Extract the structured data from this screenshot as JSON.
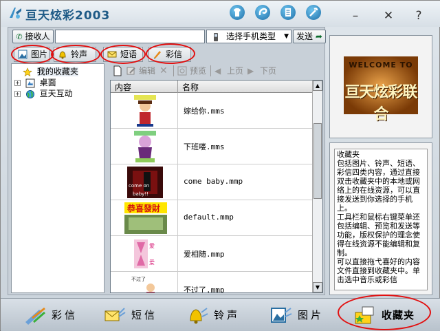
{
  "app": {
    "title": "亘天炫彩2003",
    "controls": {
      "minimize": "–",
      "close": "✕",
      "help": "?"
    }
  },
  "recipient": {
    "button_label": "接收人",
    "input_value": "",
    "phone_select": "选择手机类型",
    "send_label": "发送"
  },
  "tabs": [
    {
      "label": "图片",
      "icon": "picture-icon"
    },
    {
      "label": "铃声",
      "icon": "bell-icon"
    },
    {
      "label": "短语",
      "icon": "envelope-icon"
    },
    {
      "label": "彩信",
      "icon": "pen-icon"
    }
  ],
  "tree": {
    "favorites": "我的收藏夹",
    "desktop": "桌面",
    "interaction": "亘天互动"
  },
  "toolbar": {
    "edit": "编辑",
    "preview": "预览",
    "prev_page": "上页",
    "next_page": "下页"
  },
  "list": {
    "columns": [
      "内容",
      "名称"
    ],
    "rows": [
      {
        "name": "嫁给你.mms"
      },
      {
        "name": "下班喽.mms"
      },
      {
        "name": "come baby.mmp"
      },
      {
        "name": "default.mmp"
      },
      {
        "name": "爱相随.mmp"
      },
      {
        "name": "不过了.mmp"
      }
    ]
  },
  "banner": {
    "line1": "WELCOME TO",
    "line2": "亘天炫彩联合"
  },
  "description": "收藏夹\n包括图片、铃声、短语、彩信四类内容，通过直接双击收藏夹中的本地或网络上的在线资源，可以直接发送到你选择的手机上。\n工具栏和鼠标右键菜单还包括编辑、预览和发送等功能，版权保护的理念使得在线资源不能编辑和复制。\n可以直接拖弋喜好的内容文件直接到收藏夹中。单击选中音乐或彩信",
  "bottom_nav": [
    {
      "label": "彩信",
      "icon": "mms-icon"
    },
    {
      "label": "短信",
      "icon": "sms-icon"
    },
    {
      "label": "铃声",
      "icon": "ringtone-icon"
    },
    {
      "label": "图片",
      "icon": "picture-icon"
    },
    {
      "label": "收藏夹",
      "icon": "favorites-icon"
    }
  ],
  "colors": {
    "title_blue": "#1e5a86",
    "highlight_red": "#e21010",
    "panel": "#c8d0d8"
  }
}
